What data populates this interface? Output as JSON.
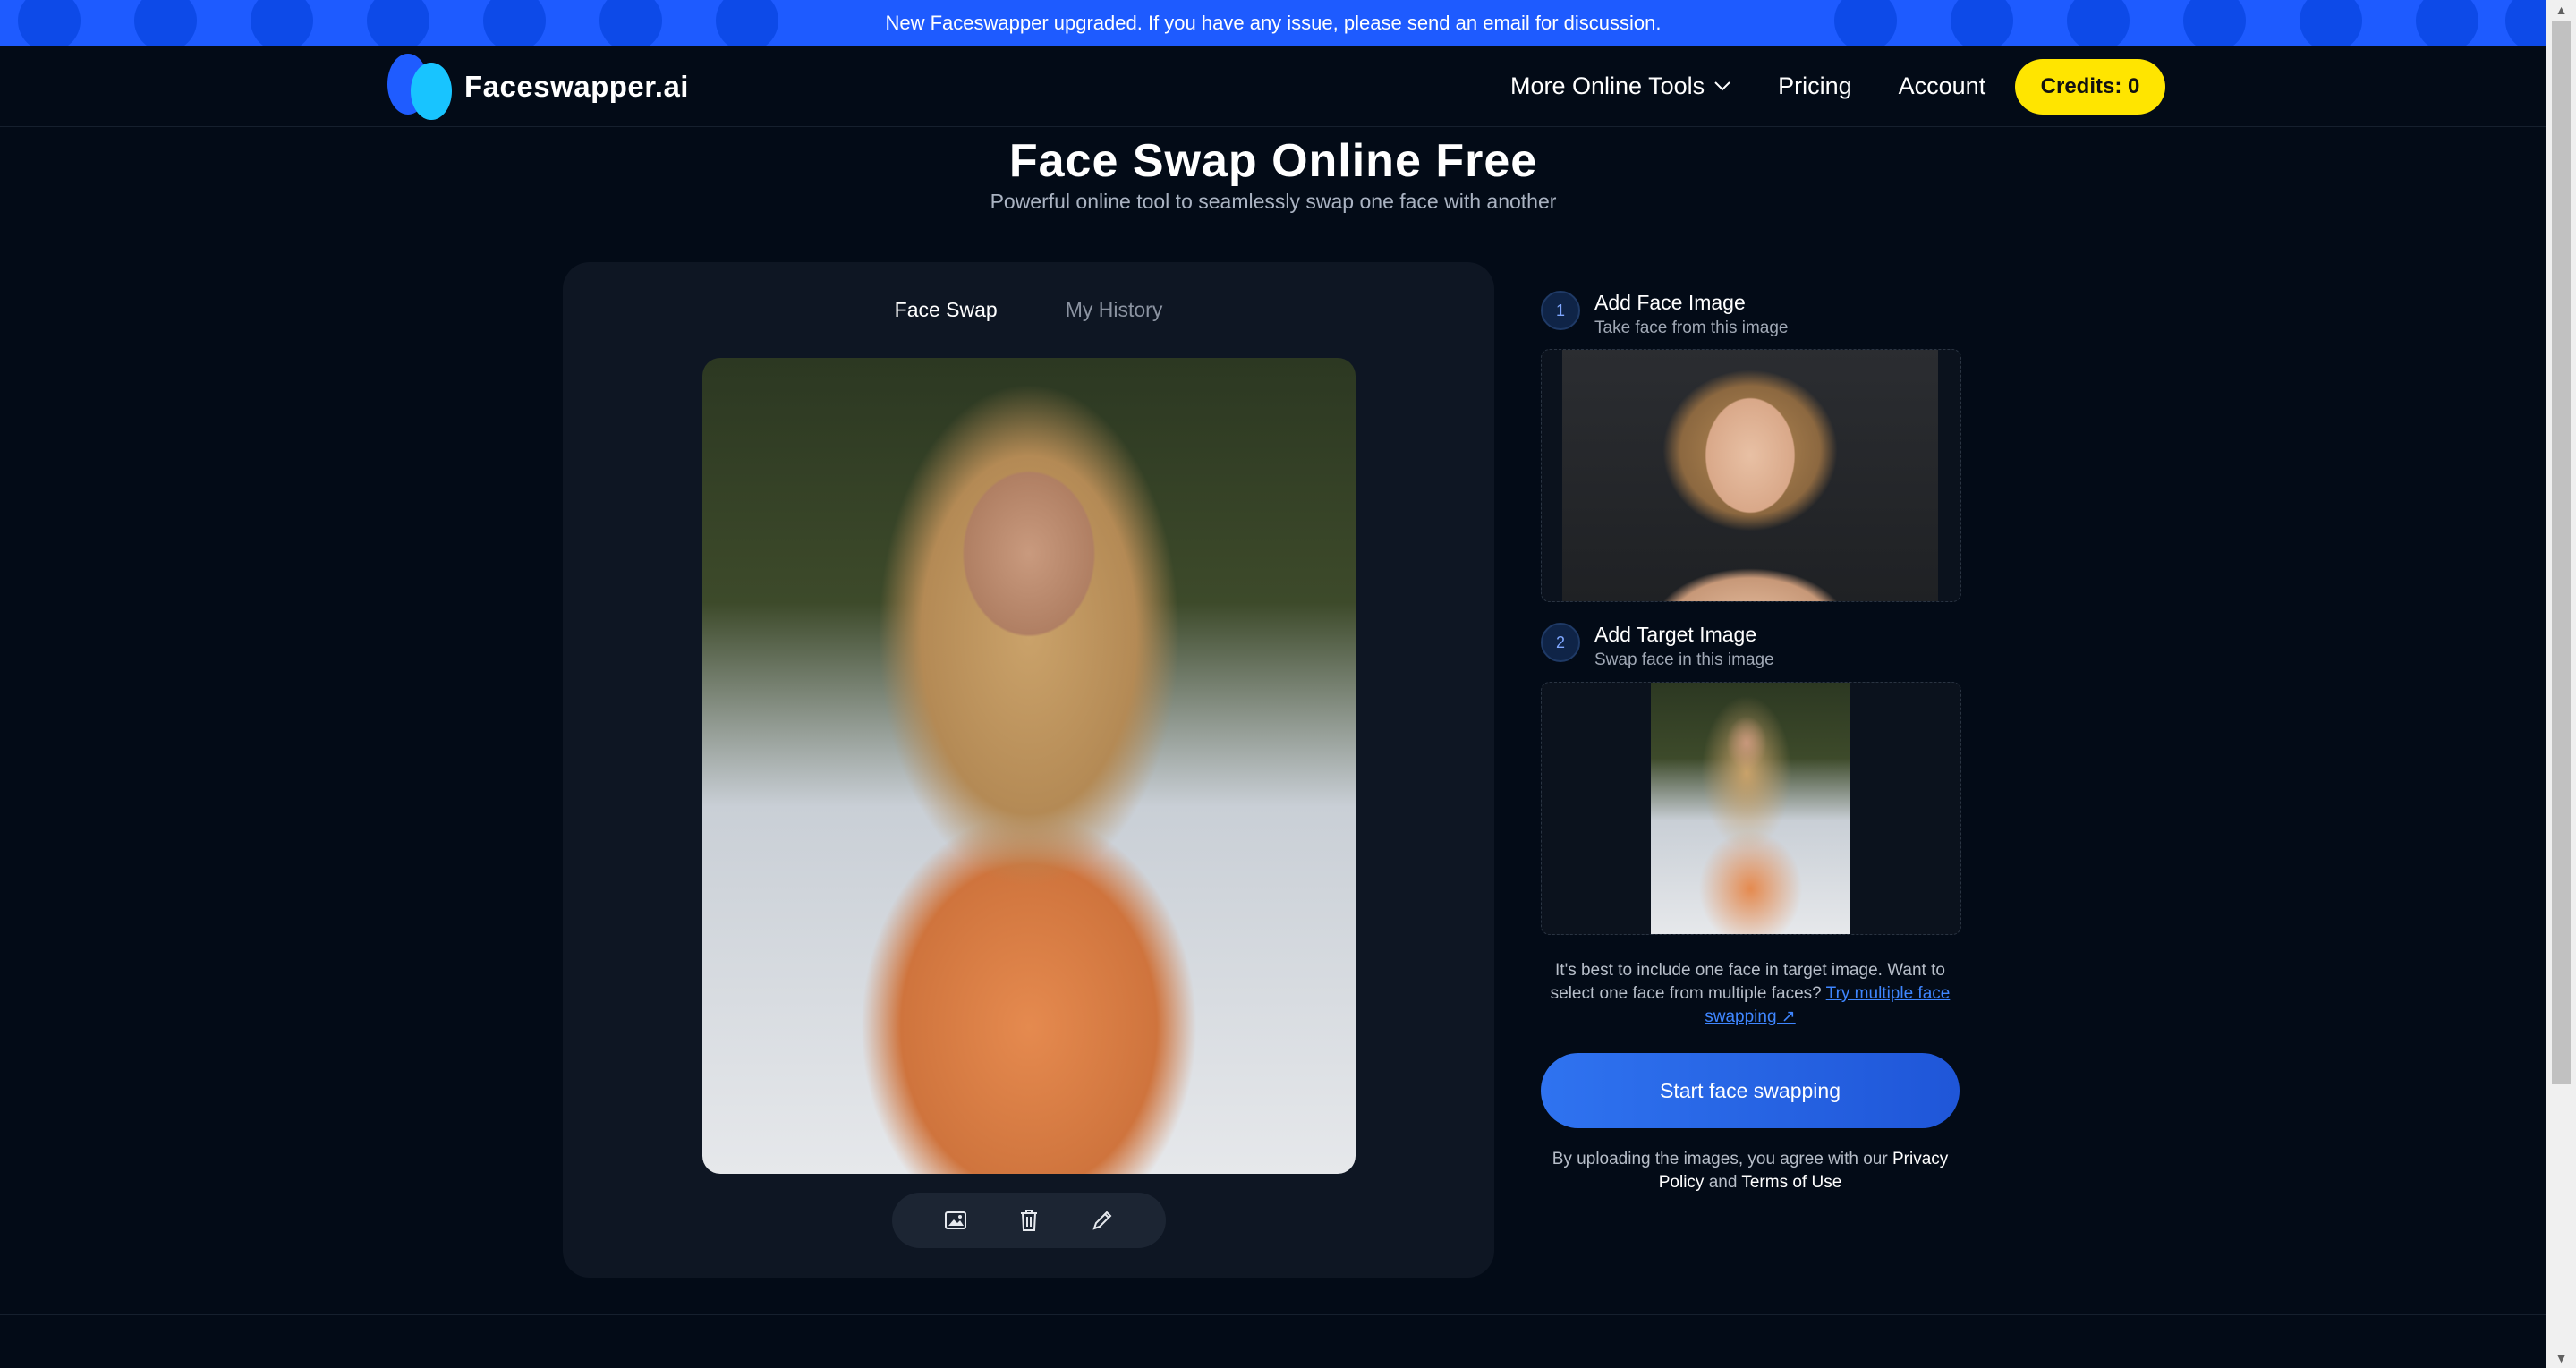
{
  "banner": {
    "text": "New Faceswapper upgraded. If you have any issue, please send an email for discussion."
  },
  "header": {
    "logo_text": "Faceswapper.ai",
    "nav": {
      "tools": "More Online Tools",
      "pricing": "Pricing",
      "account": "Account"
    },
    "credits": "Credits: 0"
  },
  "hero": {
    "title": "Face Swap Online Free",
    "subtitle": "Powerful online tool to seamlessly swap one face with another"
  },
  "card": {
    "tabs": [
      {
        "label": "Face Swap",
        "active": true
      },
      {
        "label": "My History",
        "active": false
      }
    ],
    "toolbar_icons": [
      "image-icon",
      "trash-icon",
      "pencil-icon"
    ]
  },
  "steps": [
    {
      "num": "1",
      "title": "Add Face Image",
      "subtitle": "Take face from this image"
    },
    {
      "num": "2",
      "title": "Add Target Image",
      "subtitle": "Swap face in this image"
    }
  ],
  "hint": {
    "text": "It's best to include one face in target image. Want to select one face from multiple faces?",
    "link": "Try multiple face swapping ↗"
  },
  "start_button": "Start face swapping",
  "agree": {
    "prefix": "By uploading the images, you agree with our",
    "privacy": "Privacy Policy",
    "and": "and",
    "terms": "Terms of Use"
  },
  "colors": {
    "background": "#030b17",
    "banner": "#1e5bff",
    "credits": "#ffe500",
    "accent": "#2f73f0"
  }
}
